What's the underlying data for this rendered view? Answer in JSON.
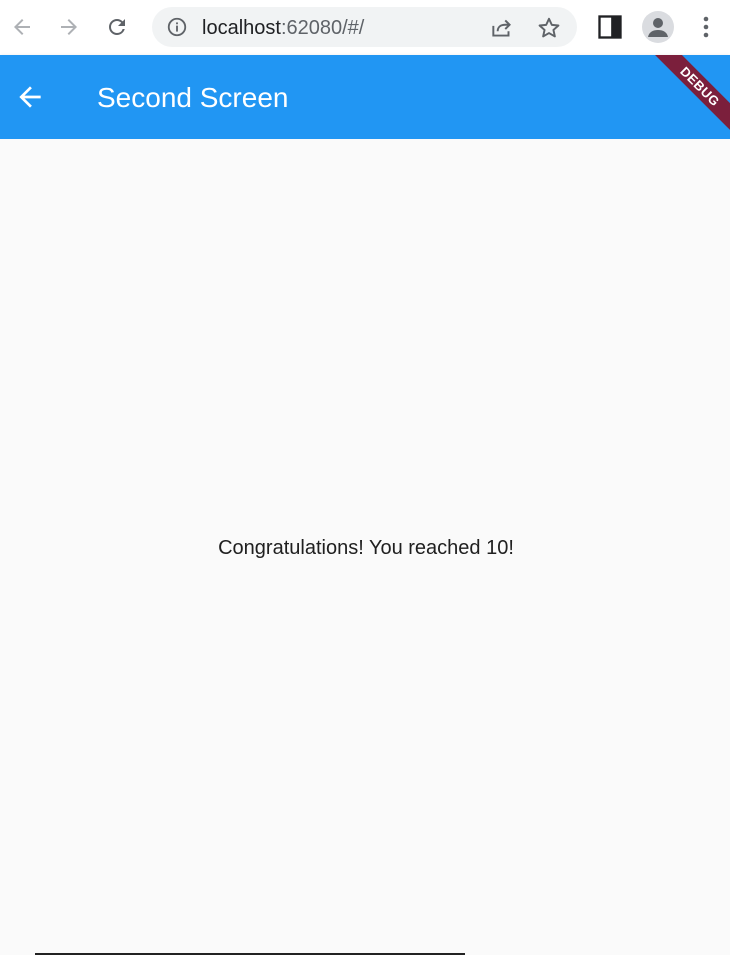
{
  "browser": {
    "url_host": "localhost",
    "url_rest": ":62080/#/",
    "icons": [
      "back-arrow-icon",
      "forward-arrow-icon",
      "reload-icon",
      "info-icon",
      "share-icon",
      "star-icon",
      "side-panel-icon",
      "profile-icon",
      "more-vert-icon"
    ]
  },
  "app_bar": {
    "title": "Second Screen",
    "debug_label": "DEBUG",
    "color": "#2196f3"
  },
  "main": {
    "message": "Congratulations! You reached 10!"
  }
}
